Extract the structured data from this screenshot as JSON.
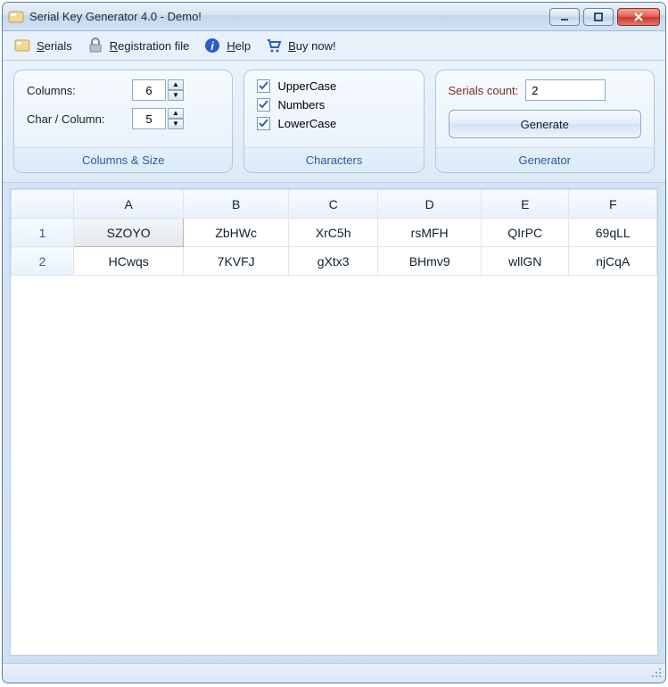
{
  "window": {
    "title": "Serial Key Generator 4.0 - Demo!"
  },
  "menu": {
    "serials": "Serials",
    "registration": "Registration file",
    "help": "Help",
    "buy": "Buy now!"
  },
  "panel_columns": {
    "columns_label": "Columns:",
    "columns_value": "6",
    "char_label": "Char / Column:",
    "char_value": "5",
    "footer": "Columns & Size"
  },
  "panel_chars": {
    "upper_label": "UpperCase",
    "upper_checked": true,
    "numbers_label": "Numbers",
    "numbers_checked": true,
    "lower_label": "LowerCase",
    "lower_checked": true,
    "footer": "Characters"
  },
  "panel_gen": {
    "count_label": "Serials count:",
    "count_value": "2",
    "generate_label": "Generate",
    "footer": "Generator"
  },
  "grid": {
    "headers": [
      "A",
      "B",
      "C",
      "D",
      "E",
      "F"
    ],
    "rows": [
      {
        "num": "1",
        "cells": [
          "SZOYO",
          "ZbHWc",
          "XrC5h",
          "rsMFH",
          "QIrPC",
          "69qLL"
        ],
        "selected_col": 0
      },
      {
        "num": "2",
        "cells": [
          "HCwqs",
          "7KVFJ",
          "gXtx3",
          "BHmv9",
          "wllGN",
          "njCqA"
        ],
        "selected_col": -1
      }
    ]
  }
}
